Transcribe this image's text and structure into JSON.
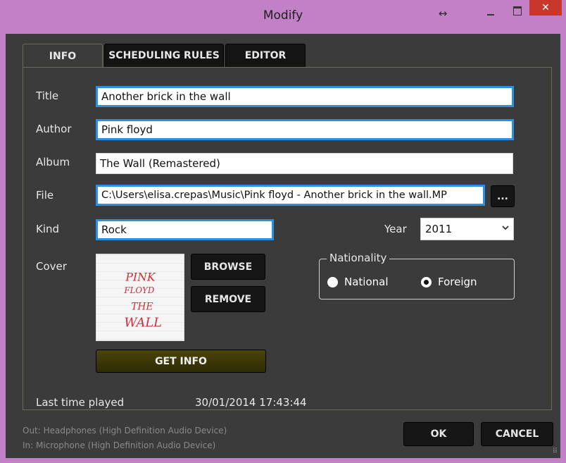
{
  "window": {
    "title": "Modify",
    "resize_glyph": "↔",
    "close_glyph": "✕"
  },
  "tabs": [
    {
      "label": "INFO",
      "active": true
    },
    {
      "label": "SCHEDULING RULES",
      "active": false
    },
    {
      "label": "EDITOR",
      "active": false
    }
  ],
  "form": {
    "title_label": "Title",
    "title_value": "Another brick in the wall",
    "author_label": "Author",
    "author_value": "Pink floyd",
    "album_label": "Album",
    "album_value": "The Wall (Remastered)",
    "file_label": "File",
    "file_value": "C:\\Users\\elisa.crepas\\Music\\Pink floyd - Another brick in the wall.MP",
    "file_browse_label": "...",
    "kind_label": "Kind",
    "kind_value": "Rock",
    "year_label": "Year",
    "year_value": "2011",
    "cover_label": "Cover",
    "browse_label": "BROWSE",
    "remove_label": "REMOVE",
    "get_info_label": "GET INFO",
    "nationality_label": "Nationality",
    "national_label": "National",
    "foreign_label": "Foreign",
    "nationality_selected": "Foreign",
    "last_played_label": "Last time played",
    "last_played_value": "30/01/2014 17:43:44"
  },
  "cover_art": {
    "line1": "PINK",
    "line2": "FLOYD",
    "line3": "THE",
    "line4": "WALL"
  },
  "footer": {
    "out_device": "Out: Headphones (High Definition Audio Device)",
    "in_device": "In: Microphone (High Definition Audio Device)",
    "ok_label": "OK",
    "cancel_label": "CANCEL"
  },
  "colors": {
    "frame": "#c281c6",
    "background": "#3b3b3b",
    "focus_border": "#2b8fe3",
    "get_info_button": "#3f3a08",
    "close_button": "#c7372b"
  }
}
